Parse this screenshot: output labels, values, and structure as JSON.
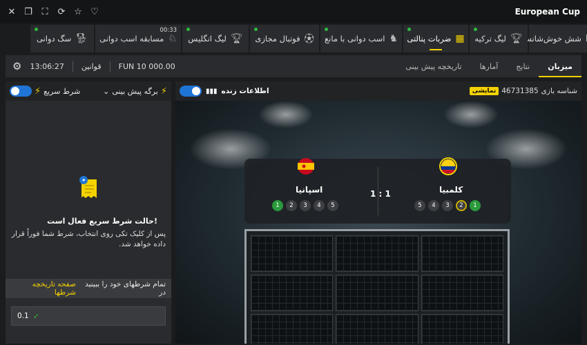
{
  "window": {
    "title": "European Cup",
    "controls": [
      "close-icon",
      "restore-icon",
      "fullscreen-icon",
      "refresh-icon",
      "star-icon",
      "heart-icon"
    ]
  },
  "games_tabs": [
    {
      "label": "شش خوش‌شانس",
      "icon": "dice-icon",
      "live": false
    },
    {
      "label": "لیگ ترکیه",
      "icon": "trophy-icon",
      "live": true
    },
    {
      "label": "ضربات پنالتی",
      "icon": "goal-icon",
      "live": true,
      "active": true
    },
    {
      "label": "اسب دوانی با مانع",
      "icon": "horse-jump-icon",
      "live": true
    },
    {
      "label": "فوتبال مجازی",
      "icon": "ball-icon",
      "live": true
    },
    {
      "label": "لیگ انگلیس",
      "icon": "trophy-icon",
      "live": true
    },
    {
      "label": "مسابقه اسب دوانی",
      "icon": "horse-icon",
      "live": false,
      "badge": "00:33"
    },
    {
      "label": "سگ دوانی",
      "icon": "dog-icon",
      "live": true
    }
  ],
  "sub_tabs": [
    {
      "label": "میزبان",
      "active": true
    },
    {
      "label": "نتایج"
    },
    {
      "label": "آمارها"
    },
    {
      "label": "تاریخچه پیش بینی"
    }
  ],
  "info": {
    "balance": "FUN 10 000.00",
    "rules": "قوانین",
    "time": "13:06:27"
  },
  "bet_slip": {
    "title": "برگه پیش بینی",
    "quick_bet": "شرط سریع",
    "quick_title": "حالت شرط سریع فعال است!",
    "quick_text": "پس از کلیک تکی روی انتخاب، شرط شما فوراً قرار داده خواهد شد.",
    "history_prefix": "تمام شرطهای خود را ببینید در",
    "history_link": "صفحه تاریخچه شرطها",
    "stake": "0.1"
  },
  "stage": {
    "game_id_label": "شناسه بازی",
    "game_id": "46731385",
    "demo": "نمایشی",
    "live_info": "اطلاعات زنده",
    "score": "1 : 1",
    "home": {
      "name": "کلمبیا",
      "penalties": [
        "1",
        "2",
        "3",
        "4",
        "5"
      ],
      "current": "2"
    },
    "away": {
      "name": "اسپانیا",
      "penalties": [
        "1",
        "2",
        "3",
        "4",
        "5"
      ]
    }
  }
}
